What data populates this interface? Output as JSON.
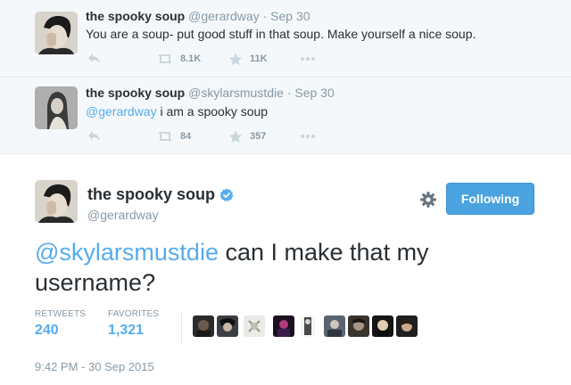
{
  "context_tweets": [
    {
      "name": "the spooky soup",
      "handle": "@gerardway",
      "separator": "·",
      "date": "Sep 30",
      "mention": "",
      "text": "You are a soup- put good stuff in that soup. Make yourself a nice soup.",
      "retweets": "8.1K",
      "favorites": "11K"
    },
    {
      "name": "the spooky soup",
      "handle": "@skylarsmustdie",
      "separator": "·",
      "date": "Sep 30",
      "mention": "@gerardway",
      "text": " i am a spooky soup",
      "retweets": "84",
      "favorites": "357"
    }
  ],
  "main_tweet": {
    "name": "the spooky soup",
    "handle": "@gerardway",
    "follow_label": "Following",
    "mention": "@skylarsmustdie",
    "text": " can I make that my username?",
    "stats": {
      "retweets_label": "RETWEETS",
      "retweets": "240",
      "favorites_label": "FAVORITES",
      "favorites": "1,321"
    },
    "timestamp": "9:42 PM - 30 Sep 2015"
  },
  "colors": {
    "accent": "#55acee",
    "follow_button": "#4aa3df",
    "context_bg": "#f5f8fa",
    "muted": "#8899a6"
  },
  "icons": [
    "reply-icon",
    "retweet-icon",
    "favorite-icon",
    "more-icon",
    "verified-icon",
    "gear-icon"
  ]
}
